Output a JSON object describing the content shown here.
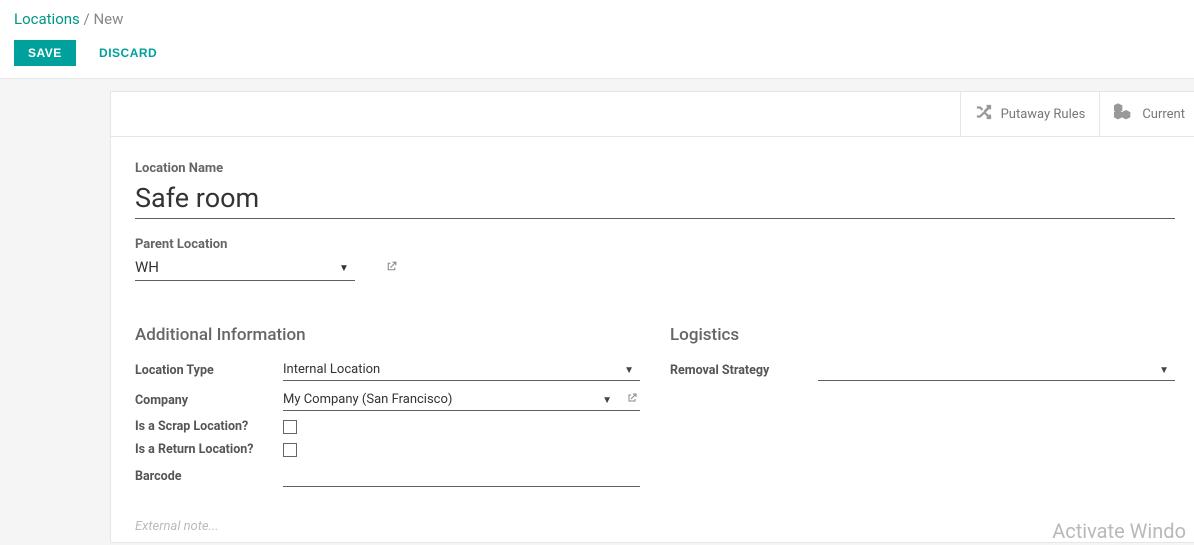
{
  "breadcrumb": {
    "root": "Locations",
    "sep": "/",
    "current": "New"
  },
  "actions": {
    "save": "SAVE",
    "discard": "DISCARD"
  },
  "stat_buttons": {
    "putaway_rules": "Putaway Rules",
    "current_stock": "Current"
  },
  "fields": {
    "location_name_label": "Location Name",
    "location_name_value": "Safe room",
    "parent_location_label": "Parent Location",
    "parent_location_value": "WH"
  },
  "sections": {
    "additional_info": "Additional Information",
    "logistics": "Logistics"
  },
  "additional": {
    "location_type_label": "Location Type",
    "location_type_value": "Internal Location",
    "company_label": "Company",
    "company_value": "My Company (San Francisco)",
    "scrap_label": "Is a Scrap Location?",
    "return_label": "Is a Return Location?",
    "barcode_label": "Barcode",
    "barcode_value": ""
  },
  "logistics": {
    "removal_strategy_label": "Removal Strategy",
    "removal_strategy_value": ""
  },
  "notes": {
    "placeholder": "External note..."
  },
  "watermark": "Activate Windo"
}
